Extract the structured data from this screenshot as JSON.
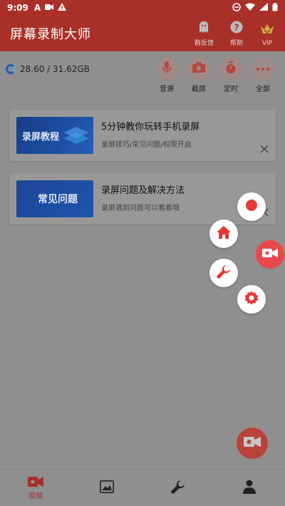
{
  "status_bar": {
    "time": "9:09"
  },
  "header": {
    "title": "屏幕录制大师",
    "actions": [
      {
        "label": "群反馈",
        "icon": "ghost-icon"
      },
      {
        "label": "帮助",
        "icon": "help-icon"
      },
      {
        "label": "VIP",
        "icon": "crown-icon"
      }
    ]
  },
  "storage": {
    "text": "28.60 / 31.62GB"
  },
  "tools": [
    {
      "label": "音源",
      "icon": "mic-icon"
    },
    {
      "label": "截屏",
      "icon": "camera-icon"
    },
    {
      "label": "定时",
      "icon": "timer-icon"
    },
    {
      "label": "全部",
      "icon": "more-icon"
    }
  ],
  "cards": [
    {
      "thumb_text": "录屏教程",
      "title": "5分钟教你玩转手机录屏",
      "subtitle": "录屏技巧/常见问题/权限开启"
    },
    {
      "thumb_text": "常见问题",
      "title": "录屏问题及解决方法",
      "subtitle": "录屏遇到问题可以看看哦"
    }
  ],
  "bottom_nav": [
    {
      "label": "视频",
      "icon": "video-icon",
      "active": true
    },
    {
      "label": "",
      "icon": "image-icon"
    },
    {
      "label": "",
      "icon": "wrench-icon"
    },
    {
      "label": "",
      "icon": "person-icon"
    }
  ],
  "colors": {
    "brand": "#a93028",
    "record": "#e8494b",
    "fab_icon": "#e53935"
  }
}
